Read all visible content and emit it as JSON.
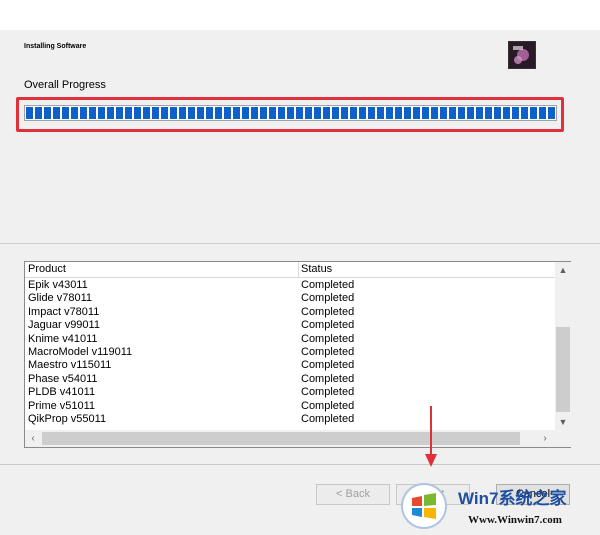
{
  "window": {
    "title": "Installing Software"
  },
  "progress": {
    "label": "Overall Progress",
    "fraction": 1.0
  },
  "list": {
    "columns": [
      "Product",
      "Status"
    ],
    "rows": [
      {
        "product": "Epik v43011",
        "status": "Completed"
      },
      {
        "product": "Glide v78011",
        "status": "Completed"
      },
      {
        "product": "Impact v78011",
        "status": "Completed"
      },
      {
        "product": "Jaguar v99011",
        "status": "Completed"
      },
      {
        "product": "Knime v41011",
        "status": "Completed"
      },
      {
        "product": "MacroModel v119011",
        "status": "Completed"
      },
      {
        "product": "Maestro v115011",
        "status": "Completed"
      },
      {
        "product": "Phase v54011",
        "status": "Completed"
      },
      {
        "product": "PLDB v41011",
        "status": "Completed"
      },
      {
        "product": "Prime v51011",
        "status": "Completed"
      },
      {
        "product": "QikProp v55011",
        "status": "Completed"
      }
    ]
  },
  "buttons": {
    "back": "< Back",
    "next": "Next",
    "cancel": "Cancel"
  },
  "watermark": {
    "brand": "Win7系统之家",
    "url": "Www.Winwin7.com"
  },
  "colors": {
    "progress": "#1060cc",
    "highlight": "#e0303a",
    "arrow": "#e0303a"
  },
  "icons": [
    "app-logo-icon",
    "scroll-up-icon",
    "scroll-down-icon",
    "scroll-left-icon",
    "scroll-right-icon",
    "red-arrow-icon"
  ]
}
